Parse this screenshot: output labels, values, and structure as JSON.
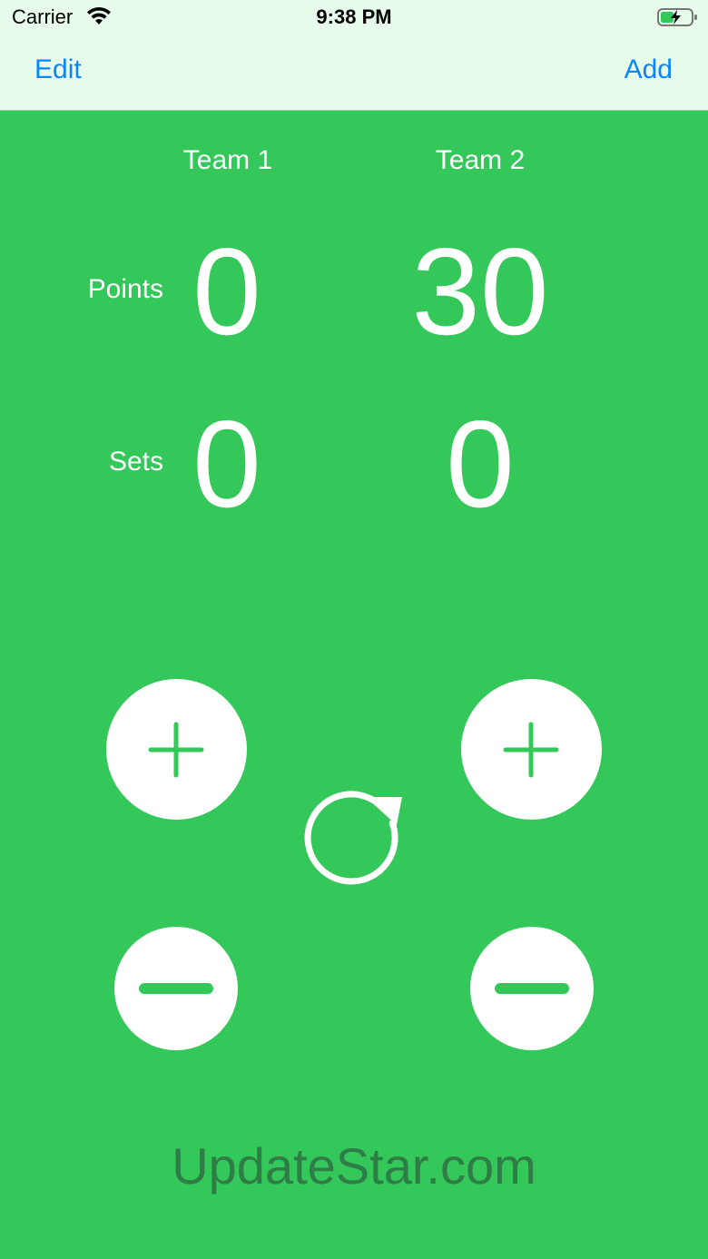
{
  "status_bar": {
    "carrier": "Carrier",
    "time": "9:38 PM",
    "wifi_icon": "wifi-icon",
    "battery_icon": "battery-charging-icon"
  },
  "nav": {
    "edit_label": "Edit",
    "add_label": "Add"
  },
  "teams": {
    "team1": "Team 1",
    "team2": "Team 2"
  },
  "labels": {
    "points": "Points",
    "sets": "Sets"
  },
  "scores": {
    "team1_points": "0",
    "team2_points": "30",
    "team1_sets": "0",
    "team2_sets": "0"
  },
  "controls": {
    "plus_icon": "plus-icon",
    "minus_icon": "minus-icon",
    "reset_icon": "reset-icon"
  },
  "watermark": "UpdateStar.com",
  "colors": {
    "background": "#34C759",
    "nav_bar": "#E6FBEA",
    "nav_text": "#0A84FF",
    "watermark": "#2E7D47"
  }
}
